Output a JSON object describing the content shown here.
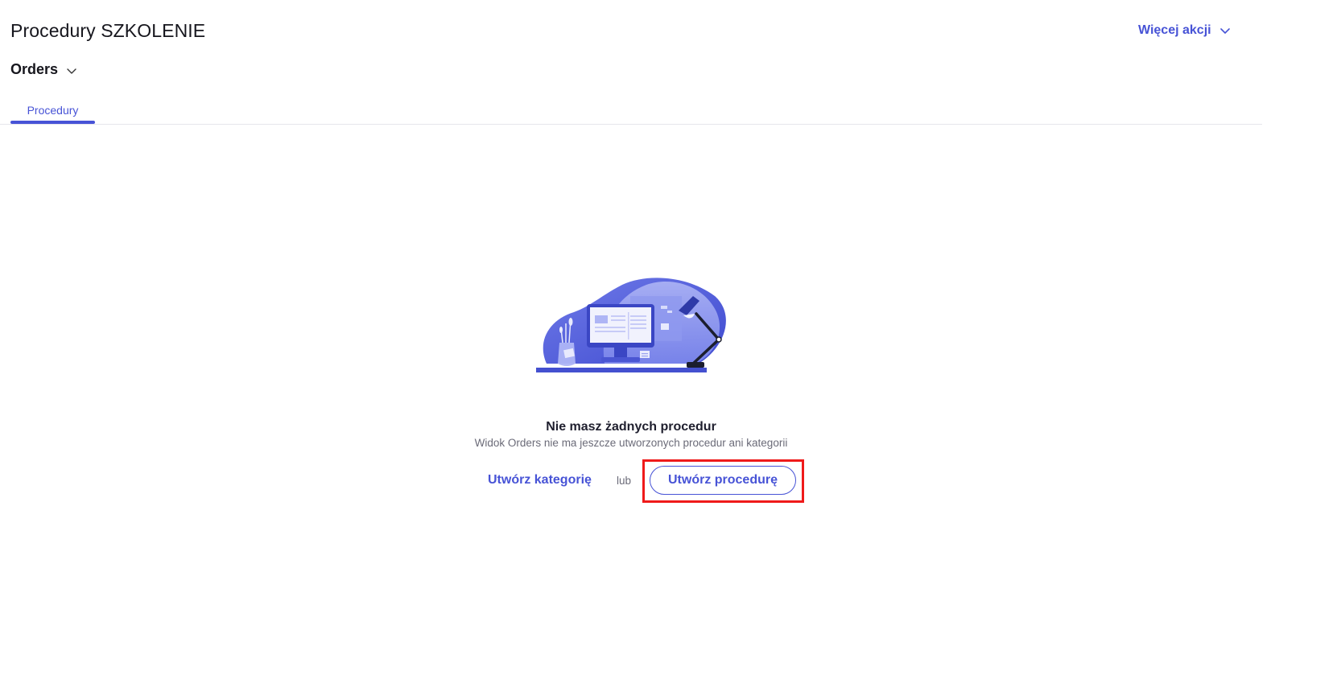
{
  "header": {
    "title": "Procedury SZKOLENIE",
    "more_actions_label": "Więcej akcji"
  },
  "view": {
    "selected": "Orders"
  },
  "tabs": [
    {
      "label": "Procedury",
      "active": true
    }
  ],
  "empty_state": {
    "illustration": "desk-computer-lamp-illustration",
    "title": "Nie masz żadnych procedur",
    "subtitle": "Widok Orders nie ma jeszcze utworzonych procedur ani kategorii",
    "create_category_label": "Utwórz kategorię",
    "or_label": "lub",
    "create_procedure_label": "Utwórz procedurę"
  },
  "colors": {
    "accent": "#4753d6",
    "highlight": "#ef1a1a"
  }
}
